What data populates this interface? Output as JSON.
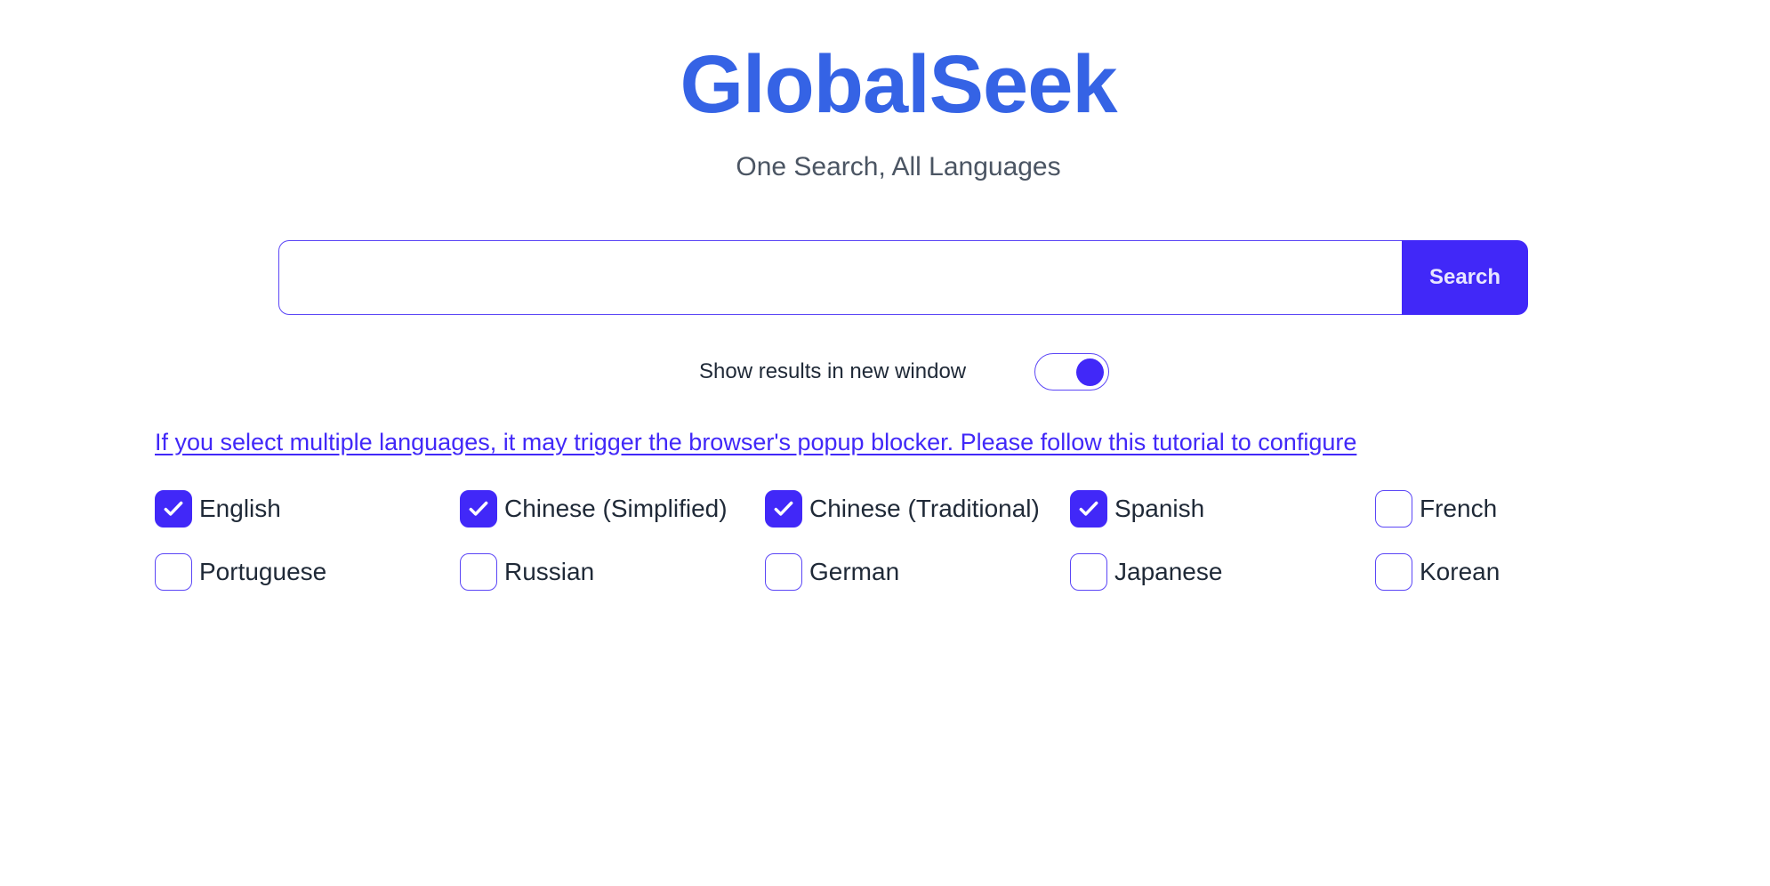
{
  "app": {
    "title": "GlobalSeek",
    "tagline": "One Search, All Languages"
  },
  "search": {
    "value": "",
    "placeholder": "",
    "button_label": "Search"
  },
  "toggle": {
    "label": "Show results in new window",
    "on": true
  },
  "notice": {
    "text": "If you select multiple languages, it may trigger the browser's popup blocker. Please follow this tutorial to configure"
  },
  "colors": {
    "brand": "#3563e5",
    "accent": "#4128f8",
    "border": "#5b46f6"
  },
  "languages": [
    {
      "label": "English",
      "checked": true
    },
    {
      "label": "Chinese (Simplified)",
      "checked": true
    },
    {
      "label": "Chinese (Traditional)",
      "checked": true
    },
    {
      "label": "Spanish",
      "checked": true
    },
    {
      "label": "French",
      "checked": false
    },
    {
      "label": "Portuguese",
      "checked": false
    },
    {
      "label": "Russian",
      "checked": false
    },
    {
      "label": "German",
      "checked": false
    },
    {
      "label": "Japanese",
      "checked": false
    },
    {
      "label": "Korean",
      "checked": false
    }
  ]
}
